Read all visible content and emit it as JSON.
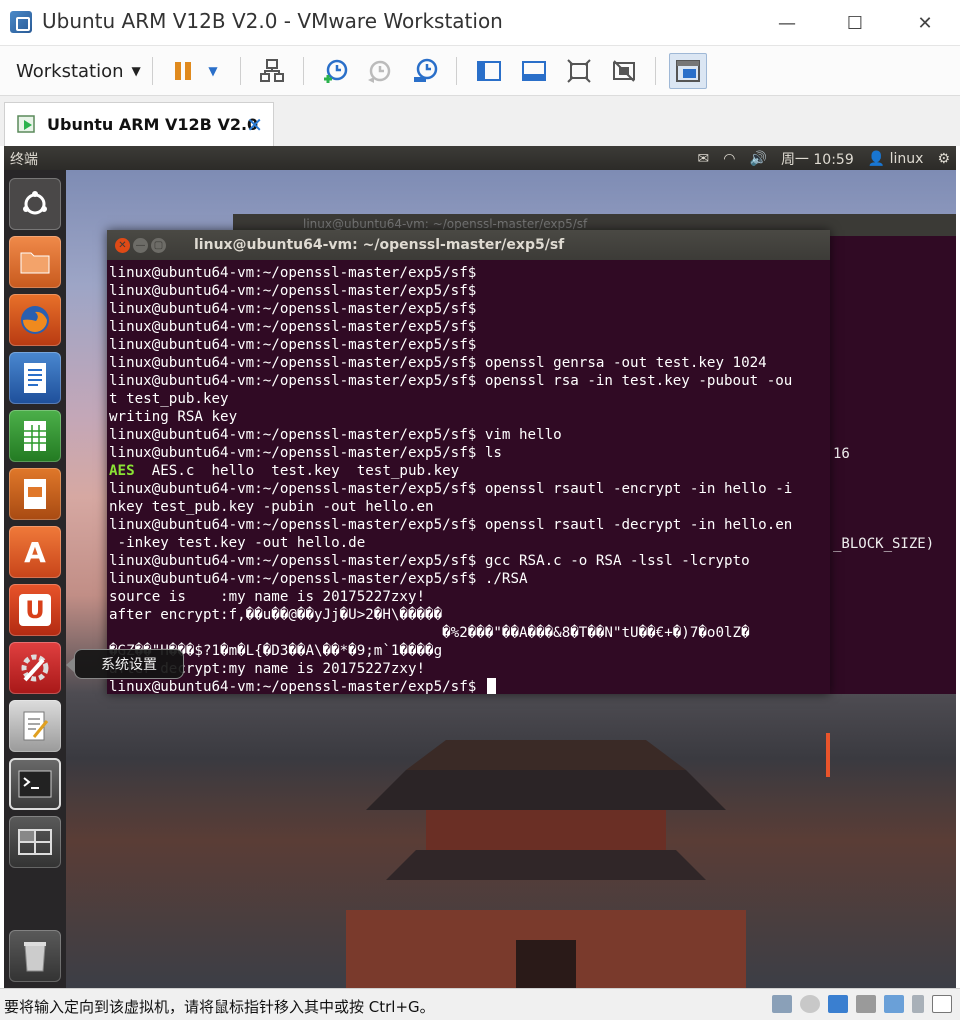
{
  "window": {
    "title": "Ubuntu ARM V12B V2.0 - VMware Workstation",
    "minimize": "—",
    "maximize": "☐",
    "close": "✕"
  },
  "toolbar": {
    "menu_label": "Workstation",
    "menu_arrow": "▼",
    "pause_arrow": "▼"
  },
  "tab": {
    "label": "Ubuntu ARM V12B V2.0",
    "close": "✕"
  },
  "panel": {
    "app_name": "终端",
    "clock": "周一 10:59",
    "user": "linux"
  },
  "launcher": {
    "tooltip": "系统设置"
  },
  "terminal": {
    "title": "linux@ubuntu64-vm: ~/openssl-master/exp5/sf",
    "lines": [
      "linux@ubuntu64-vm:~/openssl-master/exp5/sf$",
      "linux@ubuntu64-vm:~/openssl-master/exp5/sf$",
      "linux@ubuntu64-vm:~/openssl-master/exp5/sf$",
      "linux@ubuntu64-vm:~/openssl-master/exp5/sf$",
      "linux@ubuntu64-vm:~/openssl-master/exp5/sf$",
      "linux@ubuntu64-vm:~/openssl-master/exp5/sf$ openssl genrsa -out test.key 1024",
      "linux@ubuntu64-vm:~/openssl-master/exp5/sf$ openssl rsa -in test.key -pubout -ou",
      "t test_pub.key",
      "writing RSA key",
      "linux@ubuntu64-vm:~/openssl-master/exp5/sf$ vim hello",
      "linux@ubuntu64-vm:~/openssl-master/exp5/sf$ ls",
      "",
      "linux@ubuntu64-vm:~/openssl-master/exp5/sf$ openssl rsautl -encrypt -in hello -i",
      "nkey test_pub.key -pubin -out hello.en",
      "linux@ubuntu64-vm:~/openssl-master/exp5/sf$ openssl rsautl -decrypt -in hello.en",
      " -inkey test.key -out hello.de",
      "linux@ubuntu64-vm:~/openssl-master/exp5/sf$ gcc RSA.c -o RSA -lssl -lcrypto",
      "linux@ubuntu64-vm:~/openssl-master/exp5/sf$ ./RSA",
      "source is    :my name is 20175227zxy!",
      "after encrypt:f,��u��@��yJj�U>2�H\\�����",
      "                                       �%2���\"��A���&8�T��N\"tU��€+�)7�o0lZ�",
      "�GZ��\"H���$?1�m�L{�D3��A\\��*�9;m`1����g",
      "after decrypt:my name is 20175227zxy!",
      "linux@ubuntu64-vm:~/openssl-master/exp5/sf$ "
    ],
    "ls_dir": "AES",
    "ls_files": "  AES.c  hello  test.key  test_pub.key"
  },
  "background_terminal": {
    "title": "linux@ubuntu64-vm: ~/openssl-master/exp5/sf",
    "fragment1": "16",
    "fragment2": "_BLOCK_SIZE)"
  },
  "statusbar": {
    "message": "要将输入定向到该虚拟机，请将鼠标指针移入其中或按 Ctrl+G。"
  },
  "colors": {
    "terminal_bg": "#300a24",
    "terminal_fg": "#ffffff",
    "ls_dir": "#8ae234",
    "panel_bg": "#3c3b37",
    "launcher_bg": "#282628"
  }
}
